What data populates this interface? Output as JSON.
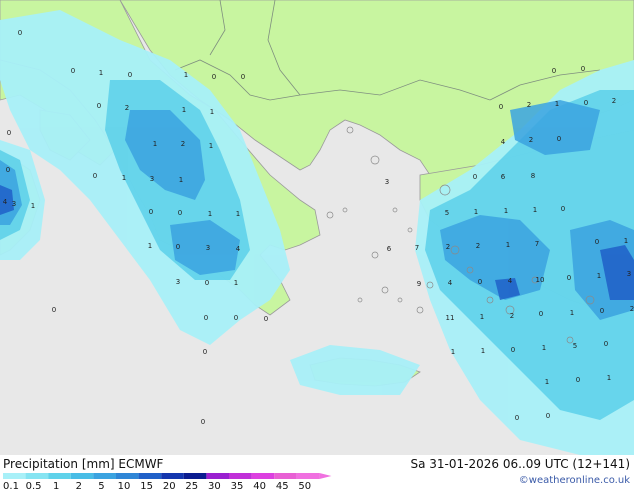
{
  "header": {
    "title": "Precipitation [mm]  ECMWF",
    "timestamp": "Sa 31-01-2026 06..09 UTC (12+141)",
    "credit": "©weatheronline.co.uk"
  },
  "legend": {
    "values": [
      "0.1",
      "0.5",
      "1",
      "2",
      "5",
      "10",
      "15",
      "20",
      "25",
      "30",
      "35",
      "40",
      "45",
      "50"
    ],
    "colors": [
      "#a8f0f8",
      "#86e4f2",
      "#5fd2ea",
      "#49bde6",
      "#3ba3e0",
      "#2f86d6",
      "#2060c8",
      "#1436ae",
      "#0b1c90",
      "#9a20d0",
      "#c030d8",
      "#dc40e0",
      "#e860d4",
      "#f070e0"
    ]
  },
  "values": [
    "0",
    "0",
    "1",
    "0",
    "1",
    "0",
    "0",
    "0",
    "2",
    "1",
    "1",
    "0",
    "1",
    "2",
    "1",
    "0",
    "0",
    "1",
    "3",
    "1",
    "4",
    "3",
    "1",
    "0",
    "0",
    "1",
    "1",
    "1",
    "0",
    "3",
    "4",
    "3",
    "0",
    "1",
    "0",
    "0",
    "0",
    "0",
    "0",
    "0",
    "0",
    "0",
    "0",
    "2",
    "1",
    "0",
    "2",
    "4",
    "2",
    "0",
    "3",
    "0",
    "6",
    "8",
    "5",
    "1",
    "1",
    "1",
    "0",
    "6",
    "7",
    "2",
    "2",
    "1",
    "7",
    "0",
    "1",
    "9",
    "4",
    "0",
    "4",
    "10",
    "0",
    "1",
    "3",
    "11",
    "1",
    "2",
    "0",
    "1",
    "0",
    "2",
    "1",
    "1",
    "0",
    "1",
    "5",
    "0",
    "1",
    "0",
    "1",
    "0",
    "0"
  ],
  "colors": {
    "sea": "#e8e8e8",
    "land": "#c8f5a0",
    "coast": "#9a9a9a",
    "border": "#7f8f7f"
  }
}
